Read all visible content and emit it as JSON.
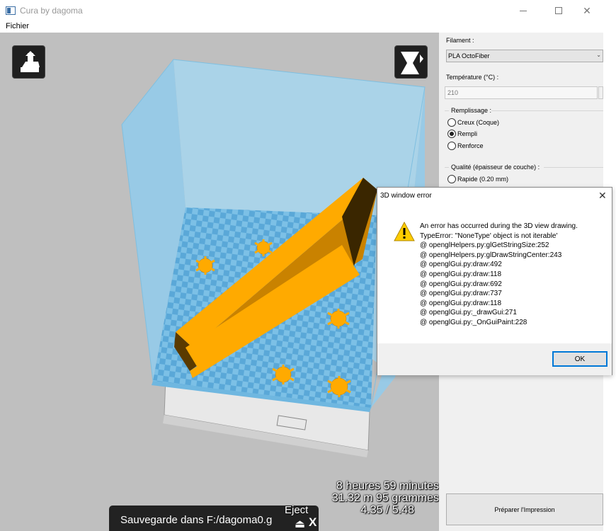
{
  "window": {
    "title": "Cura by dagoma"
  },
  "menu": {
    "file": "Fichier"
  },
  "viewport": {
    "print_time": "8 heures 59 minutes",
    "material_usage": "31.32 m 95 grammes",
    "cost": "4.35 / 5.48",
    "save_text": "Sauvegarde dans F:/dagoma0.g",
    "eject_label": "Eject"
  },
  "panel": {
    "filament_label": "Filament :",
    "filament_value": "PLA OctoFiber",
    "temperature_label": "Température (°C) :",
    "temperature_value": "210",
    "infill_label": "Remplissage :",
    "infill_options": [
      "Creux (Coque)",
      "Rempli",
      "Renforce"
    ],
    "infill_selected": "Rempli",
    "quality_label": "Qualité (épaisseur de couche) :",
    "quality_options": [
      "Rapide (0.20 mm)"
    ],
    "prepare_button": "Préparer l'Impression"
  },
  "dialog": {
    "title": "3D window error",
    "message_lines": [
      "An error has occurred during the 3D view drawing.",
      "TypeError: ''NoneType' object is not iterable'",
      " @ openglHelpers.py:glGetStringSize:252",
      " @ openglHelpers.py:glDrawStringCenter:243",
      " @ openglGui.py:draw:492",
      " @ openglGui.py:draw:118",
      " @ openglGui.py:draw:692",
      " @ openglGui.py:draw:737",
      " @ openglGui.py:draw:118",
      " @ openglGui.py:_drawGui:271",
      " @ openglGui.py:_OnGuiPaint:228"
    ],
    "ok_button": "OK"
  },
  "colors": {
    "model": "#ffaa00",
    "build_volume": "#8fd0f0",
    "viewport_bg": "#bfbfbf",
    "accent": "#0078d7"
  }
}
